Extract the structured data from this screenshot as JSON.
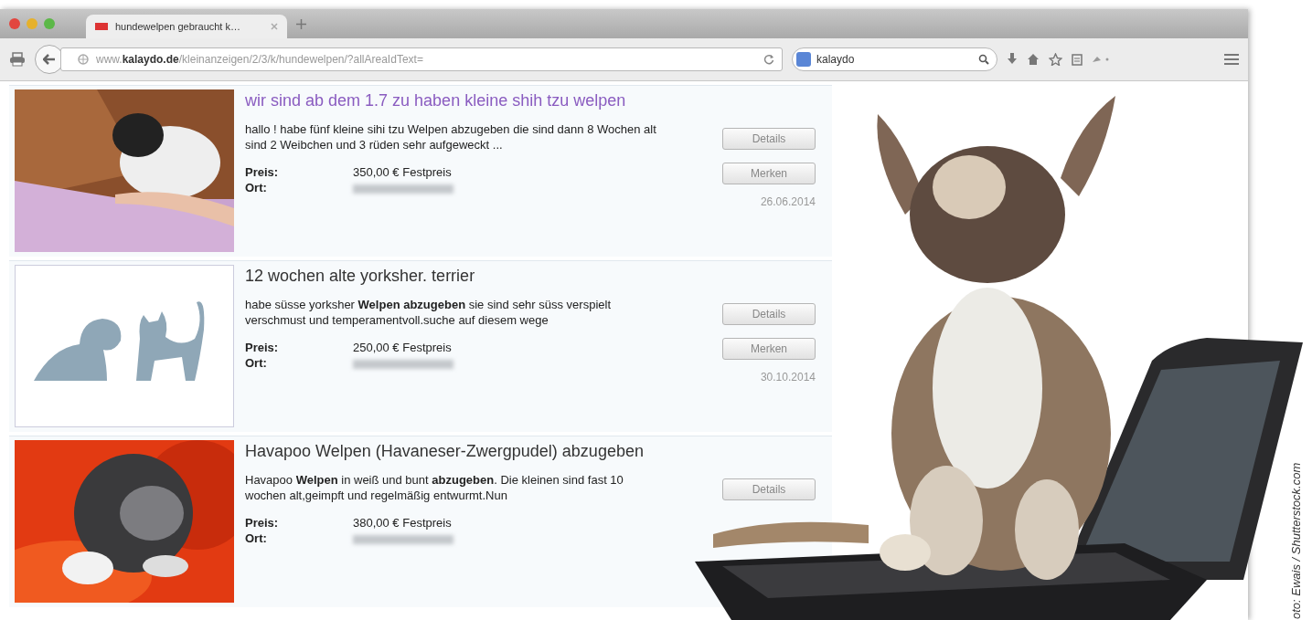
{
  "browser": {
    "tab": {
      "title": "hundewelpen gebraucht k…",
      "selected": true
    },
    "url": {
      "prefix": "www.",
      "domain": "kalaydo.de",
      "path": "/kleinanzeigen/2/3/k/hundewelpen/?allAreaIdText="
    },
    "search": {
      "value": "kalaydo"
    }
  },
  "listings": [
    {
      "visited": true,
      "title": "wir sind ab dem 1.7 zu haben kleine shih tzu welpen",
      "text": "hallo ! habe fünf kleine sihi tzu Welpen abzugeben die sind dann 8 Wochen alt sind 2 Weibchen und 3 rüden sehr aufgeweckt ...",
      "price_label": "Preis:",
      "price": "350,00 € Festpreis",
      "place_label": "Ort:",
      "buttons": [
        "Details",
        "Merken"
      ],
      "date": "26.06.2014"
    },
    {
      "kind": "placeholder",
      "visited": false,
      "title": "12 wochen alte yorksher. terrier",
      "text": "habe süsse yorksher **Welpen abzugeben** sie sind sehr süss verspielt verschmust und temperamentvoll.suche auf diesem wege",
      "price_label": "Preis:",
      "price": "250,00 € Festpreis",
      "place_label": "Ort:",
      "buttons": [
        "Details",
        "Merken"
      ],
      "date": "30.10.2014"
    },
    {
      "visited": false,
      "title": "Havapoo Welpen (Havaneser-Zwergpudel) abzugeben",
      "text": "Havapoo **Welpen** in weiß und bunt **abzugeben**. Die kleinen sind fast 10 wochen alt,geimpft und regelmäßig entwurmt.Nun",
      "price_label": "Preis:",
      "price": "380,00 € Festpreis",
      "place_label": "Ort:",
      "buttons": [
        "Details"
      ]
    }
  ],
  "credit": "oto: Ewais / Shutterstock.com"
}
